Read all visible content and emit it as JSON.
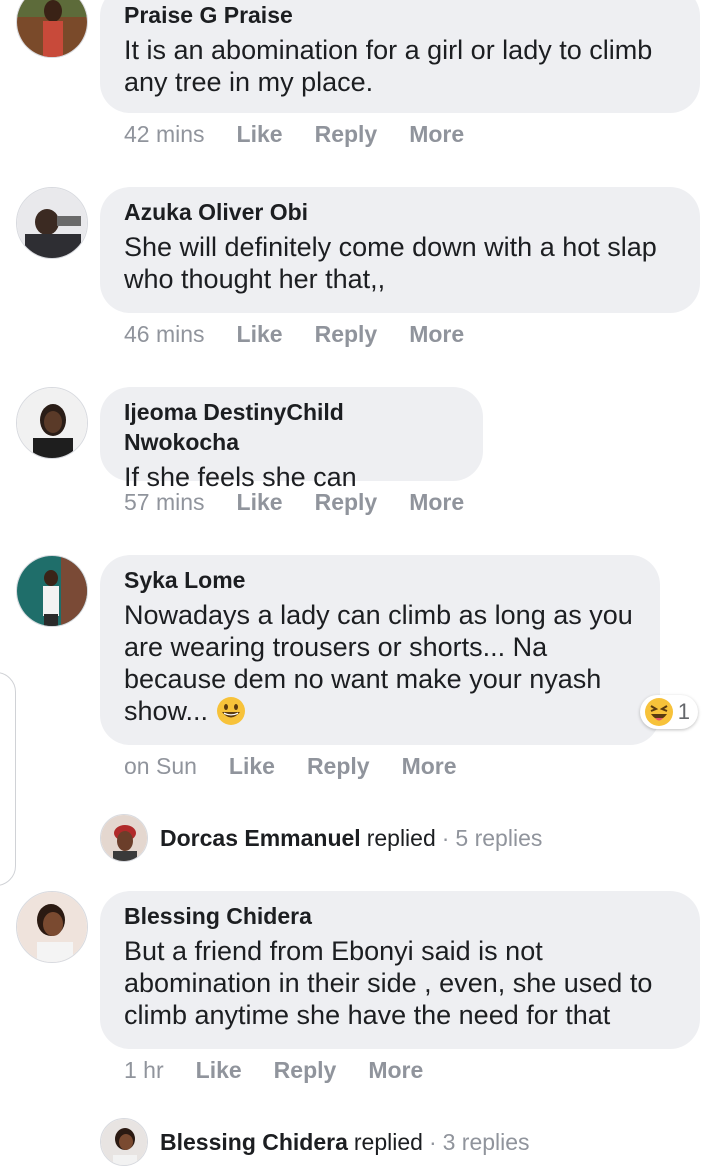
{
  "comments": [
    {
      "author": "Praise G Praise",
      "text": "It is an abomination for a girl or lady to climb any tree in my place.",
      "time": "42 mins"
    },
    {
      "author": "Azuka Oliver Obi",
      "text": "She will definitely come down with a hot slap who thought her that,,",
      "time": "46 mins"
    },
    {
      "author": "Ijeoma DestinyChild Nwokocha",
      "text": "If she feels she can",
      "time": "57 mins"
    },
    {
      "author": "Syka Lome",
      "text": "Nowadays a lady can climb as long as you are wearing trousers or shorts... Na because dem no want make your nyash show...",
      "time": "on Sun",
      "reaction_count": "1",
      "reply": {
        "name": "Dorcas Emmanuel",
        "verb": "replied",
        "count": "5 replies"
      }
    },
    {
      "author": "Blessing Chidera",
      "text": "But a friend from Ebonyi said is not abomination in their side , even, she used to climb anytime she have the need for that",
      "time": "1 hr",
      "reply": {
        "name": "Blessing Chidera",
        "verb": "replied",
        "count": "3 replies"
      }
    }
  ],
  "actions": {
    "like": "Like",
    "reply": "Reply",
    "more": "More"
  },
  "colors": {
    "bubble": "#eeeff2",
    "meta_text": "#90949c",
    "emoji": "#f7c23a"
  }
}
